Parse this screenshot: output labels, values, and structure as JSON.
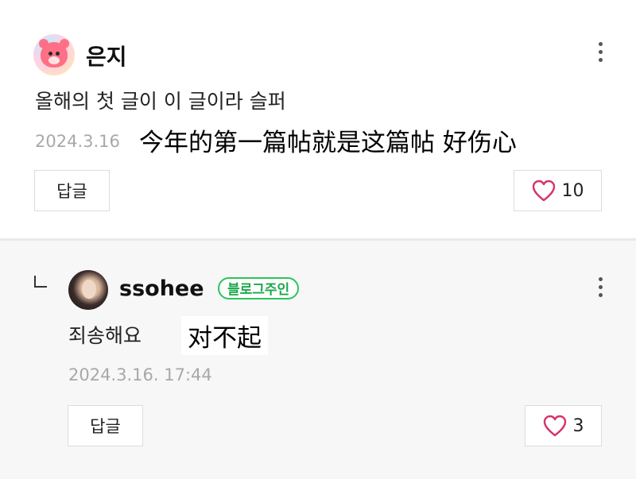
{
  "comment": {
    "author": "은지",
    "avatar_icon": "pink-bear-avatar-icon",
    "text": "올해의 첫 글이 이 글이라 슬퍼",
    "date": "2024.3.16",
    "translation": "今年的第一篇帖就是这篇帖 好伤心",
    "reply_button": "답글",
    "likes": "10",
    "more_icon": "vertical-dots-icon"
  },
  "reply": {
    "author": "ssohee",
    "badge": "블로그주인",
    "text": "죄송해요",
    "translation": "对不起",
    "date": "2024.3.16. 17:44",
    "reply_button": "답글",
    "likes": "3",
    "more_icon": "vertical-dots-icon"
  },
  "colors": {
    "badge_green": "#2bc45a",
    "heart_pink": "#d6336c",
    "reply_background": "#f7f7f7"
  }
}
